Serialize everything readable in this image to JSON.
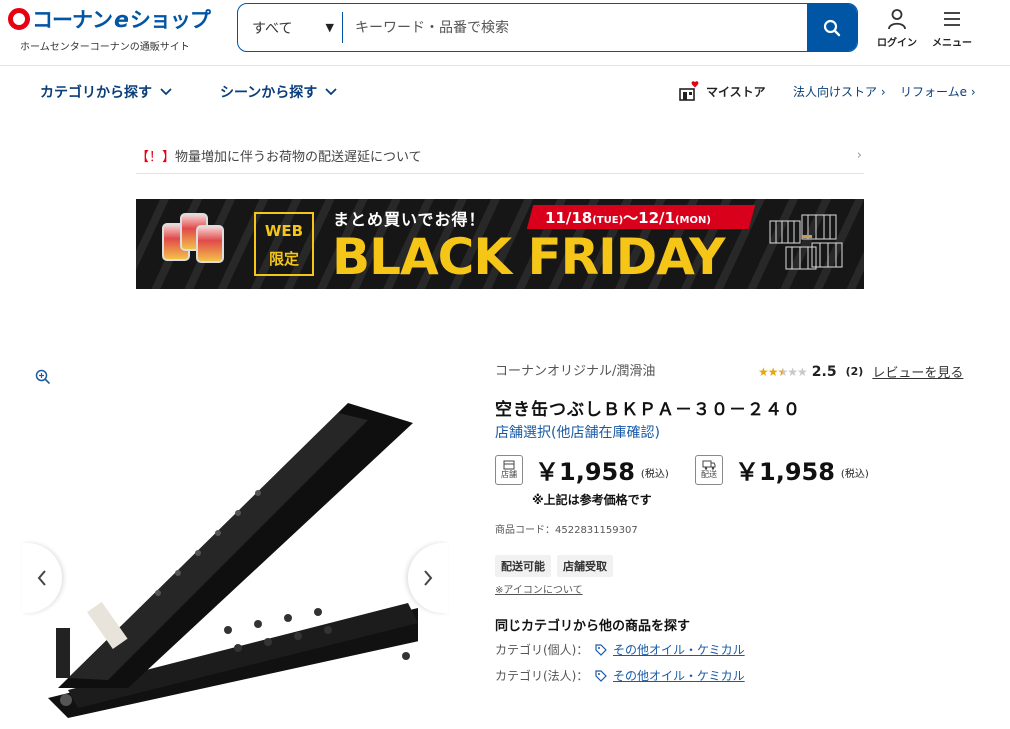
{
  "header": {
    "logo_main_prefix": "コーナン",
    "logo_main_e": "e",
    "logo_main_suffix": "ショップ",
    "logo_sub": "ホームセンターコーナンの通販サイト",
    "search_category": "すべて",
    "search_placeholder": "キーワード・品番で検索",
    "login_label": "ログイン",
    "menu_label": "メニュー"
  },
  "nav": {
    "category": "カテゴリから探す",
    "scene": "シーンから探す",
    "mystore": "マイストア",
    "corporate": "法人向けストア",
    "reform": "リフォームe"
  },
  "notice": {
    "bang": "【！】",
    "text": "物量増加に伴うお荷物の配送遅延について"
  },
  "banner": {
    "web_line1": "WEB",
    "web_line2": "限定",
    "tagline": "まとめ買いでお得！",
    "date_start": "11/18",
    "date_start_day": "(TUE)",
    "date_sep": "～",
    "date_end": "12/1",
    "date_end_day": "(MON)",
    "headline": "BLACK FRIDAY"
  },
  "product": {
    "brand": "コーナンオリジナル/潤滑油",
    "rating": 2.5,
    "rating_text": "2.5",
    "review_count": "(2)",
    "review_link": "レビューを見る",
    "title": "空き缶つぶしＢＫＰＡ－３０－２４０",
    "store_link": "店舗選択(他店舗在庫確認)",
    "store_price_badge": "店舗",
    "store_price": "￥1,958",
    "ship_price_badge": "配送",
    "ship_price": "￥1,958",
    "tax_label": "(税込)",
    "price_note": "※上記は参考価格です",
    "code": "商品コード：4522831159307",
    "tags": [
      "配送可能",
      "店舗受取"
    ],
    "icon_about": "※アイコンについて",
    "related_title": "同じカテゴリから他の商品を探す",
    "categories": [
      {
        "label": "カテゴリ(個人)：",
        "value": "その他オイル・ケミカル"
      },
      {
        "label": "カテゴリ(法人)：",
        "value": "その他オイル・ケミカル"
      }
    ]
  },
  "colors": {
    "brand_blue": "#0055a5",
    "brand_red": "#e60012",
    "link_blue": "#1a5ba6",
    "banner_yellow": "#f5c518"
  }
}
